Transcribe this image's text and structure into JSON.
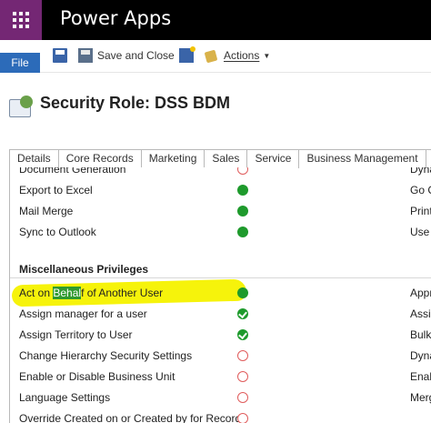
{
  "app": {
    "title": "Power Apps"
  },
  "ribbon": {
    "file_label": "File",
    "save_close_label": "Save and Close",
    "actions_label": "Actions"
  },
  "header": {
    "title": "Security Role: DSS BDM"
  },
  "tabs": [
    {
      "label": "Details"
    },
    {
      "label": "Core Records"
    },
    {
      "label": "Marketing"
    },
    {
      "label": "Sales"
    },
    {
      "label": "Service"
    },
    {
      "label": "Business Management"
    },
    {
      "label": "S"
    }
  ],
  "rows_top": [
    {
      "label": "Document Generation",
      "state": "empty",
      "right": "Dyna"
    },
    {
      "label": "Export to Excel",
      "state": "full",
      "right": "Go C"
    },
    {
      "label": "Mail Merge",
      "state": "full",
      "right": "Print"
    },
    {
      "label": "Sync to Outlook",
      "state": "full",
      "right": "Use I"
    }
  ],
  "misc_section": {
    "title": "Miscellaneous Privileges"
  },
  "highlighted_row": {
    "label_pre": "Act on ",
    "label_highlight": "Behal",
    "label_post": "f of Another User",
    "state": "full",
    "right": "Appr"
  },
  "rows_misc": [
    {
      "label": "Assign manager for a user",
      "state": "check",
      "right": "Assig"
    },
    {
      "label": "Assign Territory to User",
      "state": "check",
      "right": "Bulk"
    },
    {
      "label": "Change Hierarchy Security Settings",
      "state": "empty",
      "right": "Dyna"
    },
    {
      "label": "Enable or Disable Business Unit",
      "state": "empty",
      "right": "Enab"
    },
    {
      "label": "Language Settings",
      "state": "empty",
      "right": "Merg"
    },
    {
      "label": "Override Created on or Created by for Records",
      "state": "empty",
      "right": ""
    }
  ]
}
